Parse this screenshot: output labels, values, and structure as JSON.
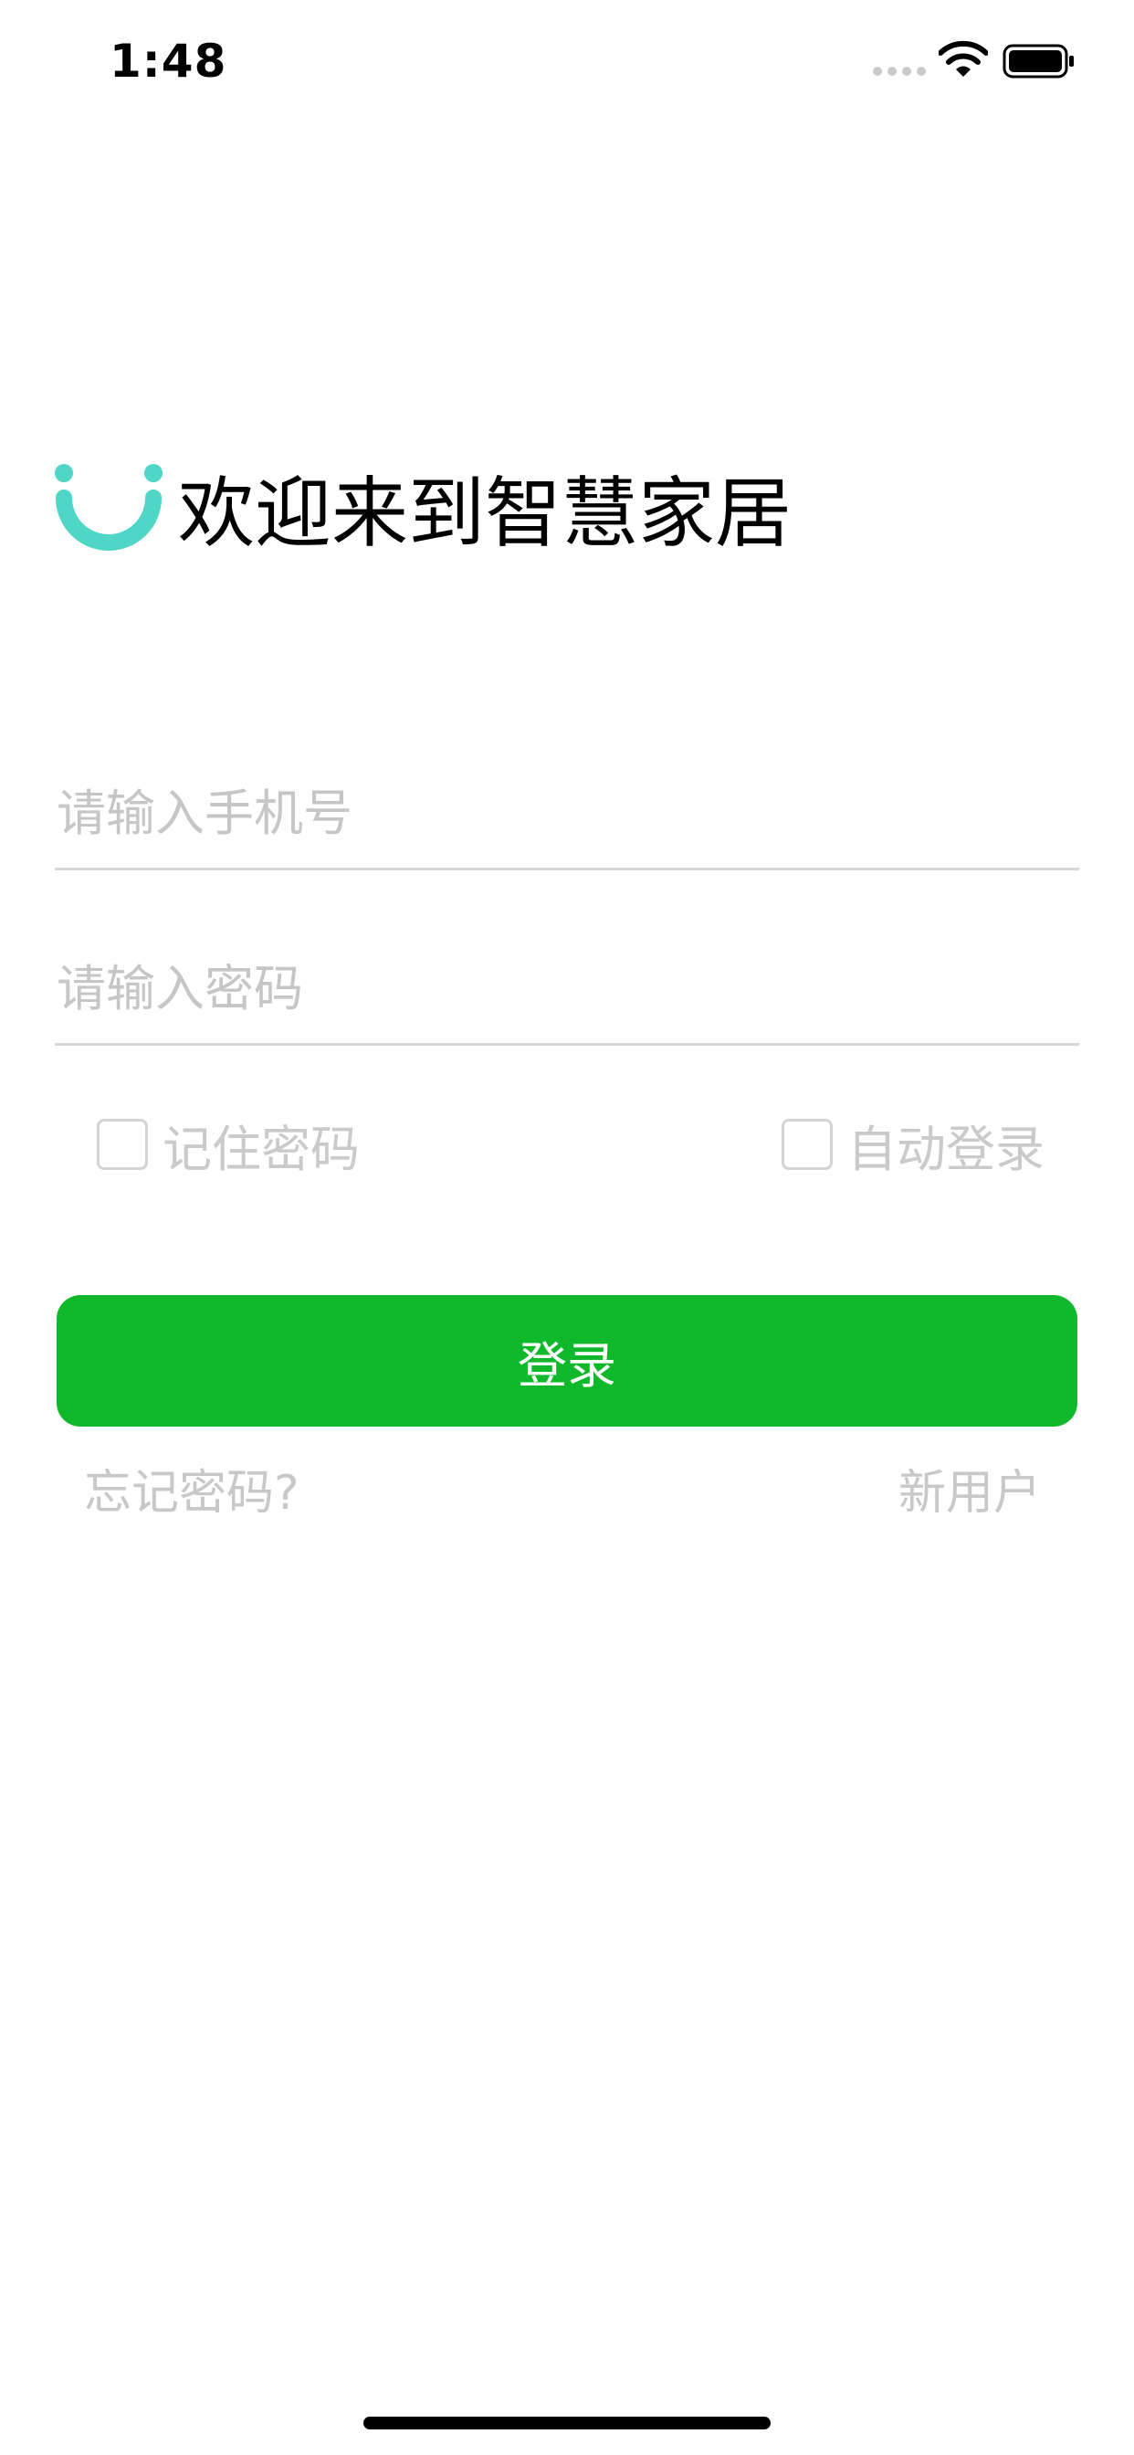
{
  "status_bar": {
    "time": "1:48",
    "icons": [
      "signal-dots-icon",
      "wifi-icon",
      "battery-icon"
    ]
  },
  "header": {
    "logo": "smile-logo-icon",
    "title": "欢迎来到智慧家居"
  },
  "form": {
    "phone_placeholder": "请输入手机号",
    "phone_value": "",
    "password_placeholder": "请输入密码",
    "password_value": "",
    "remember_password_label": "记住密码",
    "remember_password_checked": false,
    "auto_login_label": "自动登录",
    "auto_login_checked": false,
    "login_button_label": "登录"
  },
  "links": {
    "forgot_password": "忘记密码?",
    "new_user": "新用户"
  },
  "colors": {
    "accent": "#10b82b",
    "logo": "#4fd6c6",
    "placeholder": "#c6c6c6",
    "divider": "#d6d6d6"
  }
}
